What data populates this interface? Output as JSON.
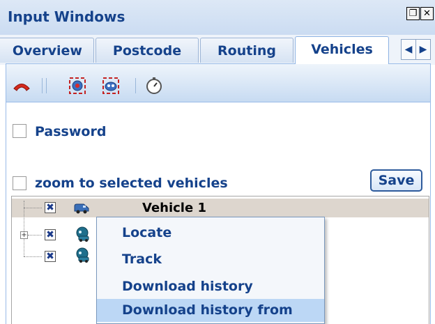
{
  "window": {
    "title": "Input Windows",
    "restore_glyph": "❐",
    "close_glyph": "✕"
  },
  "tabs": [
    {
      "label": "Overview",
      "active": false
    },
    {
      "label": "Postcode",
      "active": false
    },
    {
      "label": "Routing",
      "active": false
    },
    {
      "label": "Vehicles",
      "active": true
    }
  ],
  "tab_nav": {
    "prev_glyph": "◀",
    "next_glyph": "▶"
  },
  "toolbar": {
    "icons": [
      "phone-hangup-icon",
      "target-add-icon",
      "target-remove-icon",
      "stopwatch-icon"
    ]
  },
  "options": {
    "password_label": "Password",
    "password_checked": false,
    "zoom_label": "zoom to selected vehicles",
    "zoom_checked": false,
    "save_label": "Save"
  },
  "tree": {
    "checked_glyph": "✖",
    "expand_glyph": "+",
    "items": [
      {
        "label": "Vehicle 1",
        "checked": true,
        "icon": "van-icon",
        "selected": true
      },
      {
        "label": "",
        "checked": true,
        "icon": "car-icon",
        "selected": false,
        "expandable": true
      },
      {
        "label": "",
        "checked": true,
        "icon": "car-icon",
        "selected": false
      }
    ]
  },
  "context_menu": {
    "items": [
      {
        "label": "Locate",
        "highlighted": false
      },
      {
        "label": "Track",
        "highlighted": false
      },
      {
        "label": "Download history",
        "highlighted": false
      },
      {
        "label": "Download history from",
        "highlighted": true
      }
    ]
  },
  "colors": {
    "accent": "#15428b",
    "highlight": "#bcd7f5",
    "selected_row": "#ddd6ce"
  }
}
